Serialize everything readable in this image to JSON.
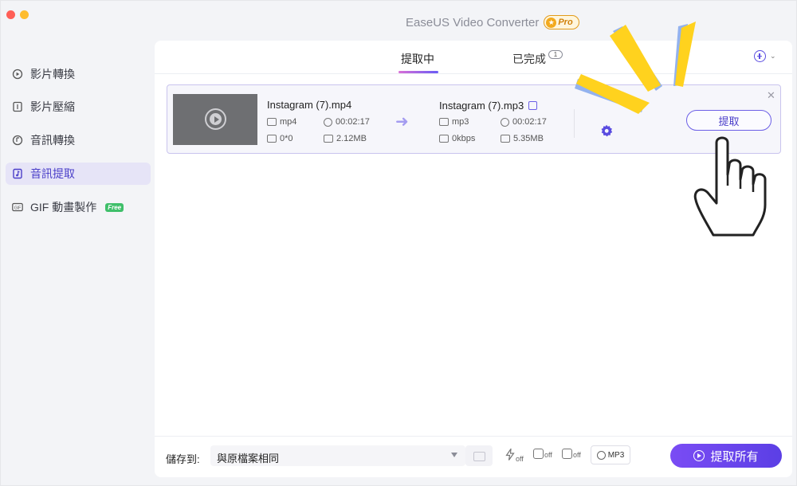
{
  "window": {
    "title": "EaseUS Video Converter",
    "pro_badge": "Pro"
  },
  "sidebar": {
    "items": [
      {
        "label": "影片轉換",
        "icon": "video-convert-icon",
        "active": false
      },
      {
        "label": "影片壓縮",
        "icon": "compress-icon",
        "active": false
      },
      {
        "label": "音訊轉換",
        "icon": "audio-convert-icon",
        "active": false
      },
      {
        "label": "音訊提取",
        "icon": "audio-extract-icon",
        "active": true
      },
      {
        "label": "GIF 動畫製作",
        "icon": "gif-icon",
        "active": false,
        "badge": "Free"
      }
    ]
  },
  "tabs": {
    "processing": "提取中",
    "done": "已完成",
    "done_count": "1"
  },
  "task": {
    "source": {
      "name": "Instagram (7).mp4",
      "format": "mp4",
      "duration": "00:02:17",
      "resolution": "0*0",
      "size": "2.12MB"
    },
    "target": {
      "name": "Instagram (7).mp3",
      "format": "mp3",
      "duration": "00:02:17",
      "bitrate": "0kbps",
      "size": "5.35MB"
    },
    "extract_label": "提取"
  },
  "bottom": {
    "save_label": "儲存到:",
    "save_location": "與原檔案相同",
    "tool_off_1": "off",
    "tool_off_2": "off",
    "tool_off_3": "off",
    "format_label": "MP3",
    "extract_all_label": "提取所有"
  },
  "colors": {
    "accent": "#5a4ce0",
    "active_bg": "#e6e4f7",
    "pro_orange": "#e29b1a",
    "free_green": "#3fbf6a",
    "highlight_yellow": "#ffd21e",
    "highlight_blue": "#93b2ee"
  }
}
